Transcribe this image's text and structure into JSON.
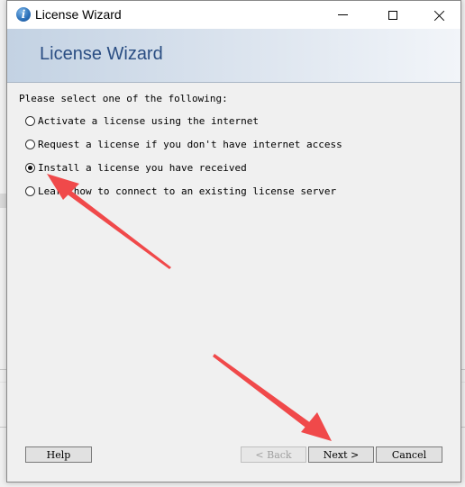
{
  "window": {
    "title": "License Wizard",
    "banner_title": "License Wizard"
  },
  "content": {
    "instruction": "Please select one of the following:",
    "options": [
      {
        "label": "Activate a license using the internet",
        "selected": false
      },
      {
        "label": "Request a license if you don't have internet access",
        "selected": false
      },
      {
        "label": "Install a license you have received",
        "selected": true
      },
      {
        "label": "Learn how to connect to an existing license server",
        "selected": false
      }
    ]
  },
  "buttons": {
    "help": "Help",
    "back": "< Back",
    "next": "Next >",
    "cancel": "Cancel"
  },
  "colors": {
    "annotation_arrow": "#f0494a",
    "banner_text": "#2b4e83"
  }
}
